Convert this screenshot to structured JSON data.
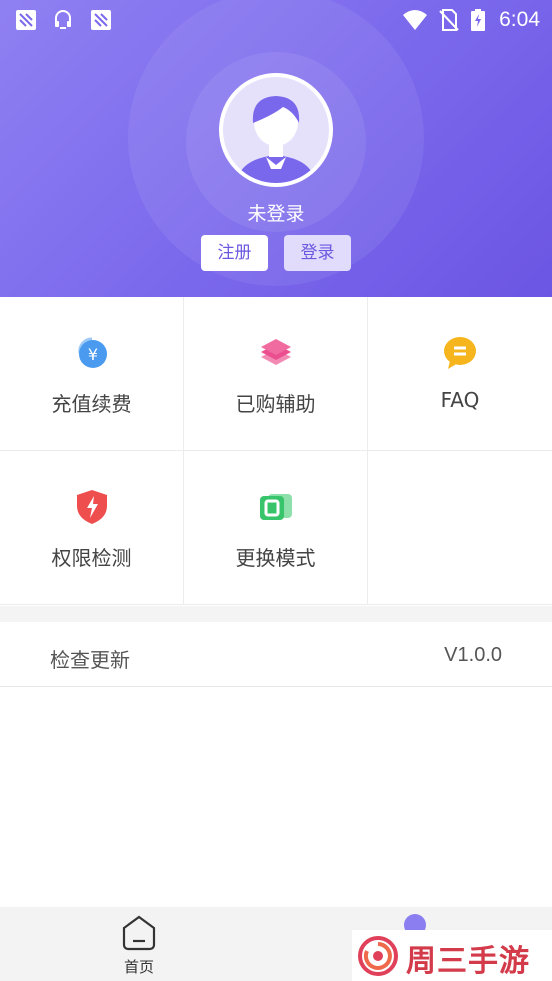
{
  "status_bar": {
    "time": "6:04",
    "left_icons": [
      "notification-icon",
      "headset-icon",
      "notification-icon"
    ],
    "right_icons": [
      "wifi-icon",
      "no-sim-icon",
      "battery-charging-icon"
    ]
  },
  "profile": {
    "username": "未登录",
    "register_label": "注册",
    "login_label": "登录",
    "accent_color": "#7a68ec"
  },
  "menu": [
    {
      "label": "充值续费",
      "icon": "recharge-icon",
      "color": "#4a9af0"
    },
    {
      "label": "已购辅助",
      "icon": "purchased-icon",
      "color": "#ec4f8f"
    },
    {
      "label": "FAQ",
      "icon": "faq-icon",
      "color": "#f6b51c"
    },
    {
      "label": "权限检测",
      "icon": "permission-check-icon",
      "color": "#ef4e4e"
    },
    {
      "label": "更换模式",
      "icon": "switch-mode-icon",
      "color": "#37c46a"
    }
  ],
  "update": {
    "label": "检查更新",
    "version": "V1.0.0"
  },
  "bottom_nav": {
    "home_label": "首页"
  },
  "watermark": {
    "text": "周三手游网"
  }
}
